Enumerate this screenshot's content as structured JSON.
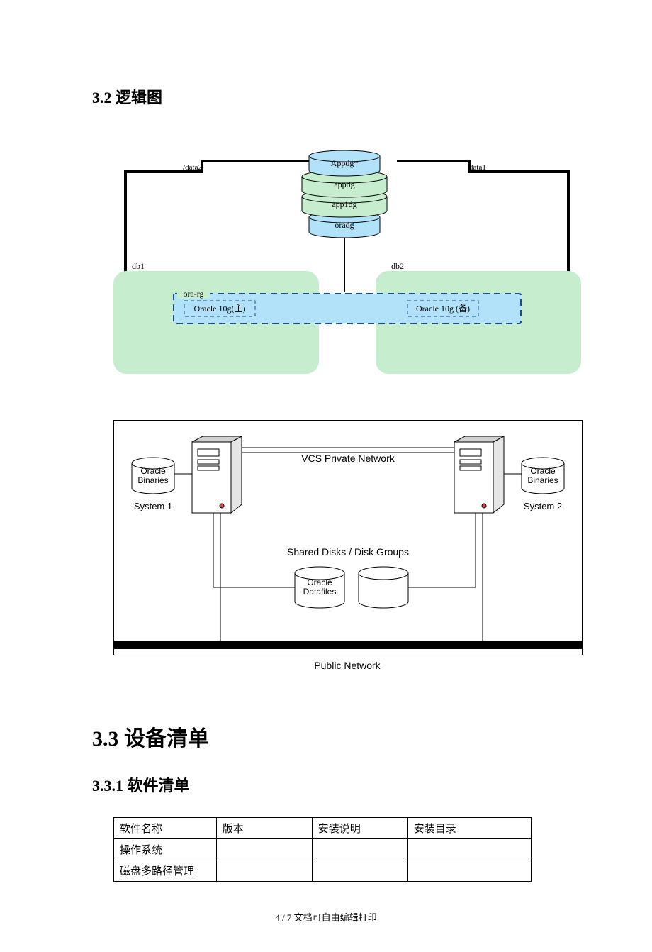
{
  "headings": {
    "h32": "3.2 逻辑图",
    "h33": "3.3 设备清单",
    "h331": "3.3.1 软件清单"
  },
  "diagram1": {
    "stack": [
      "Appdg*",
      "appdg",
      "app1dg",
      "oradg"
    ],
    "left_edge_label": "/data2",
    "right_edge_label": "data1",
    "db1": "db1",
    "db2": "db2",
    "rg": "ora-rg",
    "oracle_main": "Oracle 10g(主)",
    "oracle_backup": "Oracle 10g (备)"
  },
  "diagram2": {
    "oracle_binaries": "Oracle\nBinaries",
    "system1": "System 1",
    "system2": "System 2",
    "vcs": "VCS Private Network",
    "shared": "Shared Disks / Disk Groups",
    "datafiles": "Oracle\nDatafiles",
    "public": "Public Network"
  },
  "table": {
    "headers": [
      "软件名称",
      "版本",
      "安装说明",
      "安装目录"
    ],
    "rows": [
      [
        "操作系统",
        "",
        "",
        ""
      ],
      [
        "磁盘多路径管理",
        "",
        "",
        ""
      ]
    ]
  },
  "footer": "4 / 7 文档可自由编辑打印"
}
